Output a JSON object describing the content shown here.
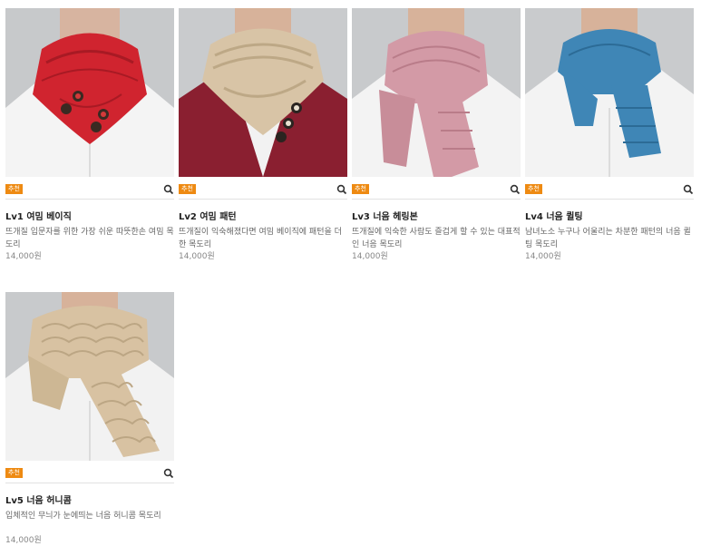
{
  "products": [
    {
      "title": "Lv1 여밈 베이직",
      "description": "뜨개질 입문자를 위한 가장 쉬운 따뜻한손 여밈 목도리",
      "price": "14,000원",
      "badge": "추천",
      "icon": "search-icon",
      "colors": {
        "scarf": "#d0242f",
        "scarf_dark": "#a81a24",
        "shirt": "#f4f4f4",
        "bg": "#c7c9cb"
      }
    },
    {
      "title": "Lv2 여밈 패턴",
      "description": "뜨개질이 익숙해졌다면 여밈 베이직에 패턴을 더한 목도리",
      "price": "14,000원",
      "badge": "추천",
      "icon": "search-icon",
      "colors": {
        "scarf": "#d8c4a6",
        "scarf_dark": "#bda886",
        "cardigan": "#8a1f30",
        "shirt": "#f2f2f2",
        "bg": "#c9cbcd"
      }
    },
    {
      "title": "Lv3 너음 헤링본",
      "description": "뜨개질에 익숙한 사람도 즐겁게 할 수 있는 대표적인 너음 목도리",
      "price": "14,000원",
      "badge": "추천",
      "icon": "search-icon",
      "colors": {
        "scarf": "#d39aa6",
        "scarf_dark": "#b97c89",
        "shirt": "#f3f3f3",
        "bg": "#c8cacc"
      }
    },
    {
      "title": "Lv4 너음 퀼팅",
      "description": "남녀노소 누구나 어울리는 차분한 패턴의 너음 퀼팅 목도리",
      "price": "14,000원",
      "badge": "추천",
      "icon": "search-icon",
      "colors": {
        "scarf": "#3f86b6",
        "scarf_dark": "#2c6b96",
        "shirt": "#f3f3f3",
        "bg": "#c9cbcd"
      }
    },
    {
      "title": "Lv5 너음 허니콤",
      "description": "입체적인 무늬가 눈에띄는 너음 허니콤 목도리",
      "price": "14,000원",
      "badge": "추천",
      "icon": "search-icon",
      "colors": {
        "scarf": "#d8c2a2",
        "scarf_dark": "#bca684",
        "shirt": "#f2f2f2",
        "bg": "#c8cacc"
      }
    }
  ]
}
